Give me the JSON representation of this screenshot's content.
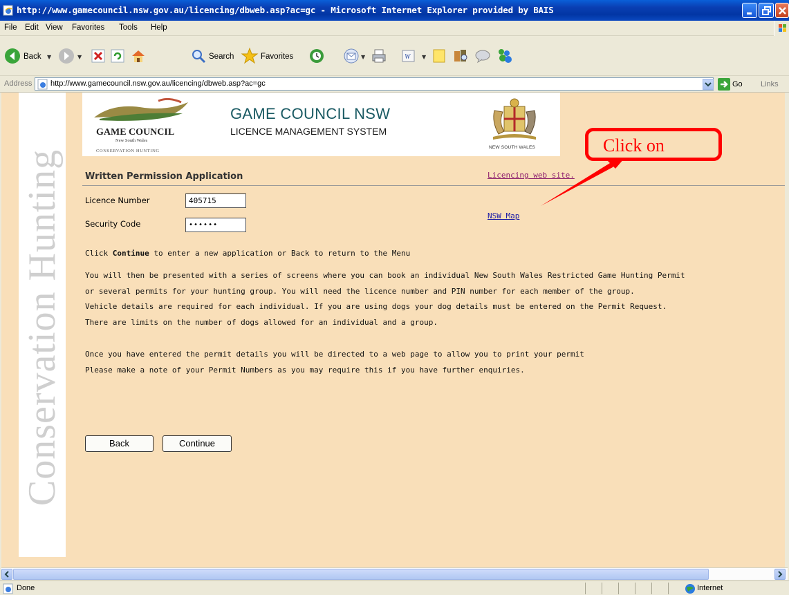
{
  "window": {
    "title": "http://www.gamecouncil.nsw.gov.au/licencing/dbweb.asp?ac=gc - Microsoft Internet Explorer provided by BAIS"
  },
  "menu": {
    "file": "File",
    "edit": "Edit",
    "view": "View",
    "favorites": "Favorites",
    "tools": "Tools",
    "help": "Help"
  },
  "toolbar": {
    "back": "Back",
    "search": "Search",
    "favorites": "Favorites"
  },
  "address": {
    "label": "Address",
    "url": "http://www.gamecouncil.nsw.gov.au/licencing/dbweb.asp?ac=gc",
    "go": "Go",
    "links": "Links"
  },
  "sidebar": {
    "text": "Conservation Hunting"
  },
  "banner": {
    "org_name": "GAME COUNCIL",
    "org_sub": "New South Wales",
    "org_tag": "CONSERVATION HUNTING",
    "heading": "GAME COUNCIL NSW",
    "subheading": "LICENCE MANAGEMENT SYSTEM",
    "crest_label": "NEW SOUTH WALES"
  },
  "page": {
    "section_title": "Written Permission Application",
    "licencing_link": "Licencing web site.",
    "map_link": "NSW Map",
    "licence_label": "Licence Number",
    "licence_value": "405715",
    "security_label": "Security Code",
    "security_value": "••••••",
    "instr_prefix": "Click ",
    "instr_bold": "Continue",
    "instr_suffix": " to enter a new application or Back to return to the Menu",
    "para1": [
      "You will then be presented with a series of screens where you can book an individual New South Wales Restricted Game Hunting Permit",
      "or several permits for your hunting group. You will need the licence number and PIN number for each member of the group.",
      "Vehicle details are required for each individual. If you are using dogs your dog details must be entered on the Permit Request.",
      "There are limits on the number of dogs allowed for an individual and a group."
    ],
    "para2": [
      "Once you have entered the permit details you will be directed to a web page to allow you to print your permit",
      "Please make a note of your Permit Numbers as you may require this if you have further enquiries."
    ],
    "back_button": "Back",
    "continue_button": "Continue"
  },
  "annotation": {
    "callout_text": "Click on",
    "color": "#ff0000"
  },
  "status": {
    "left": "Done",
    "zone": "Internet"
  },
  "colors": {
    "page_background": "#f9dfb9",
    "heading_color": "#1a5a63",
    "link": "#1a1aa6",
    "visited_link": "#8b1a6b"
  }
}
